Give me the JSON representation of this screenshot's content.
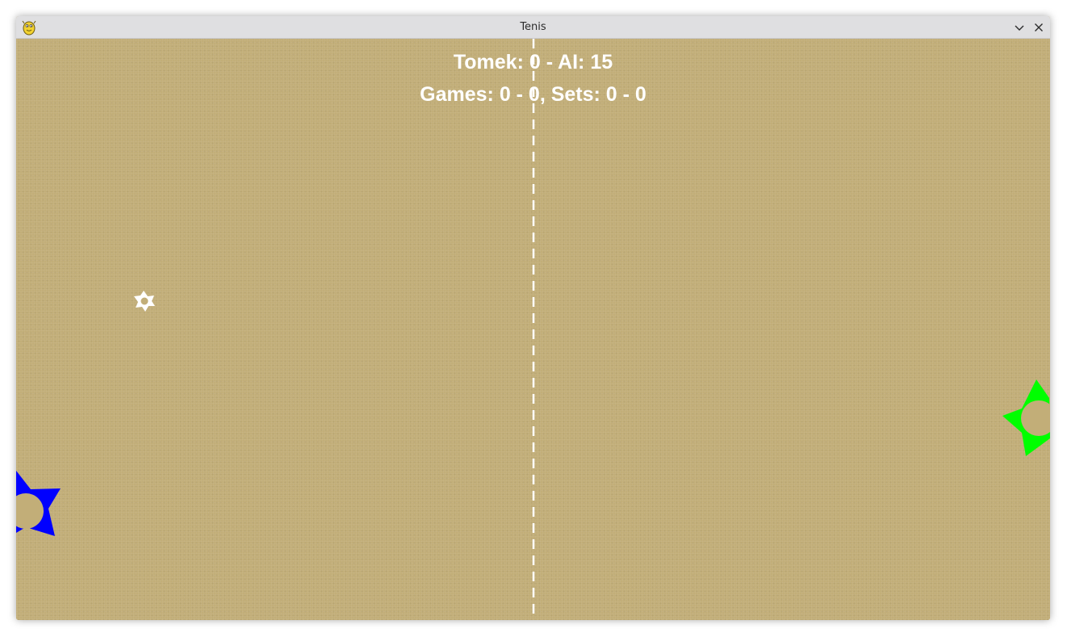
{
  "window": {
    "title": "Tenis",
    "icon": "pygame-snake-icon",
    "controls": [
      "minimize-icon",
      "close-icon"
    ]
  },
  "scoreboard": {
    "points_text": "Tomek: 0 - AI: 15",
    "games_sets_text": "Games: 0 - 0, Sets: 0 - 0"
  },
  "colors": {
    "court": "#c2ae78",
    "text": "#ffffff",
    "net": "#ffffff",
    "player_left": "#0000ff",
    "player_right": "#00ff00",
    "ball": "#ffffff"
  }
}
